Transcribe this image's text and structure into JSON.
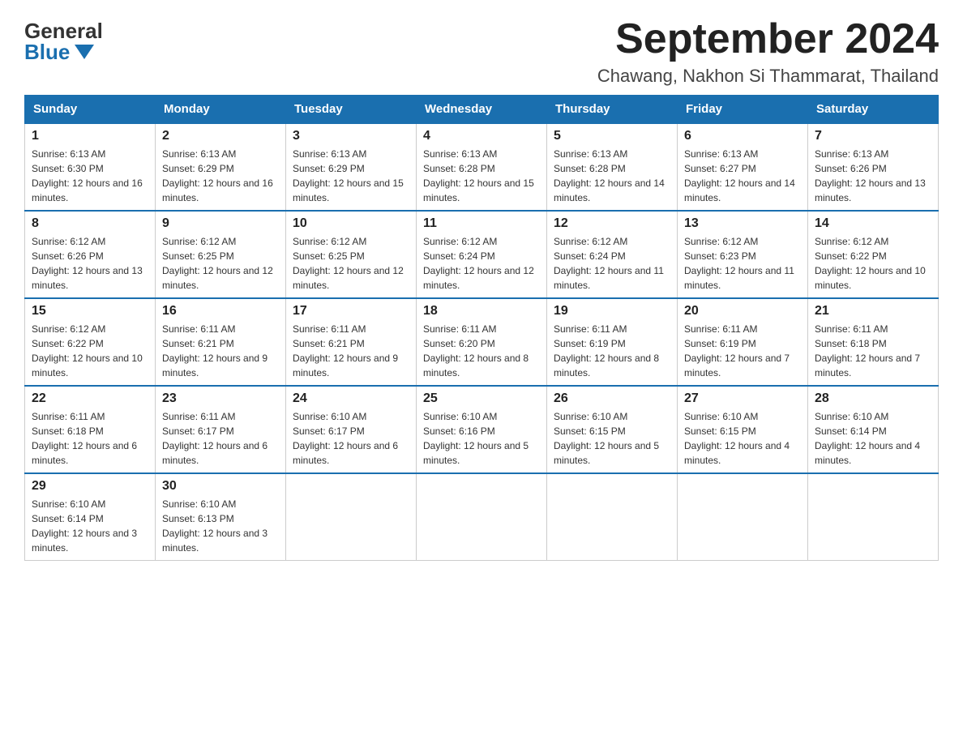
{
  "logo": {
    "general": "General",
    "blue": "Blue"
  },
  "title": "September 2024",
  "location": "Chawang, Nakhon Si Thammarat, Thailand",
  "days_of_week": [
    "Sunday",
    "Monday",
    "Tuesday",
    "Wednesday",
    "Thursday",
    "Friday",
    "Saturday"
  ],
  "weeks": [
    [
      {
        "day": "1",
        "sunrise": "6:13 AM",
        "sunset": "6:30 PM",
        "daylight": "12 hours and 16 minutes."
      },
      {
        "day": "2",
        "sunrise": "6:13 AM",
        "sunset": "6:29 PM",
        "daylight": "12 hours and 16 minutes."
      },
      {
        "day": "3",
        "sunrise": "6:13 AM",
        "sunset": "6:29 PM",
        "daylight": "12 hours and 15 minutes."
      },
      {
        "day": "4",
        "sunrise": "6:13 AM",
        "sunset": "6:28 PM",
        "daylight": "12 hours and 15 minutes."
      },
      {
        "day": "5",
        "sunrise": "6:13 AM",
        "sunset": "6:28 PM",
        "daylight": "12 hours and 14 minutes."
      },
      {
        "day": "6",
        "sunrise": "6:13 AM",
        "sunset": "6:27 PM",
        "daylight": "12 hours and 14 minutes."
      },
      {
        "day": "7",
        "sunrise": "6:13 AM",
        "sunset": "6:26 PM",
        "daylight": "12 hours and 13 minutes."
      }
    ],
    [
      {
        "day": "8",
        "sunrise": "6:12 AM",
        "sunset": "6:26 PM",
        "daylight": "12 hours and 13 minutes."
      },
      {
        "day": "9",
        "sunrise": "6:12 AM",
        "sunset": "6:25 PM",
        "daylight": "12 hours and 12 minutes."
      },
      {
        "day": "10",
        "sunrise": "6:12 AM",
        "sunset": "6:25 PM",
        "daylight": "12 hours and 12 minutes."
      },
      {
        "day": "11",
        "sunrise": "6:12 AM",
        "sunset": "6:24 PM",
        "daylight": "12 hours and 12 minutes."
      },
      {
        "day": "12",
        "sunrise": "6:12 AM",
        "sunset": "6:24 PM",
        "daylight": "12 hours and 11 minutes."
      },
      {
        "day": "13",
        "sunrise": "6:12 AM",
        "sunset": "6:23 PM",
        "daylight": "12 hours and 11 minutes."
      },
      {
        "day": "14",
        "sunrise": "6:12 AM",
        "sunset": "6:22 PM",
        "daylight": "12 hours and 10 minutes."
      }
    ],
    [
      {
        "day": "15",
        "sunrise": "6:12 AM",
        "sunset": "6:22 PM",
        "daylight": "12 hours and 10 minutes."
      },
      {
        "day": "16",
        "sunrise": "6:11 AM",
        "sunset": "6:21 PM",
        "daylight": "12 hours and 9 minutes."
      },
      {
        "day": "17",
        "sunrise": "6:11 AM",
        "sunset": "6:21 PM",
        "daylight": "12 hours and 9 minutes."
      },
      {
        "day": "18",
        "sunrise": "6:11 AM",
        "sunset": "6:20 PM",
        "daylight": "12 hours and 8 minutes."
      },
      {
        "day": "19",
        "sunrise": "6:11 AM",
        "sunset": "6:19 PM",
        "daylight": "12 hours and 8 minutes."
      },
      {
        "day": "20",
        "sunrise": "6:11 AM",
        "sunset": "6:19 PM",
        "daylight": "12 hours and 7 minutes."
      },
      {
        "day": "21",
        "sunrise": "6:11 AM",
        "sunset": "6:18 PM",
        "daylight": "12 hours and 7 minutes."
      }
    ],
    [
      {
        "day": "22",
        "sunrise": "6:11 AM",
        "sunset": "6:18 PM",
        "daylight": "12 hours and 6 minutes."
      },
      {
        "day": "23",
        "sunrise": "6:11 AM",
        "sunset": "6:17 PM",
        "daylight": "12 hours and 6 minutes."
      },
      {
        "day": "24",
        "sunrise": "6:10 AM",
        "sunset": "6:17 PM",
        "daylight": "12 hours and 6 minutes."
      },
      {
        "day": "25",
        "sunrise": "6:10 AM",
        "sunset": "6:16 PM",
        "daylight": "12 hours and 5 minutes."
      },
      {
        "day": "26",
        "sunrise": "6:10 AM",
        "sunset": "6:15 PM",
        "daylight": "12 hours and 5 minutes."
      },
      {
        "day": "27",
        "sunrise": "6:10 AM",
        "sunset": "6:15 PM",
        "daylight": "12 hours and 4 minutes."
      },
      {
        "day": "28",
        "sunrise": "6:10 AM",
        "sunset": "6:14 PM",
        "daylight": "12 hours and 4 minutes."
      }
    ],
    [
      {
        "day": "29",
        "sunrise": "6:10 AM",
        "sunset": "6:14 PM",
        "daylight": "12 hours and 3 minutes."
      },
      {
        "day": "30",
        "sunrise": "6:10 AM",
        "sunset": "6:13 PM",
        "daylight": "12 hours and 3 minutes."
      },
      null,
      null,
      null,
      null,
      null
    ]
  ]
}
